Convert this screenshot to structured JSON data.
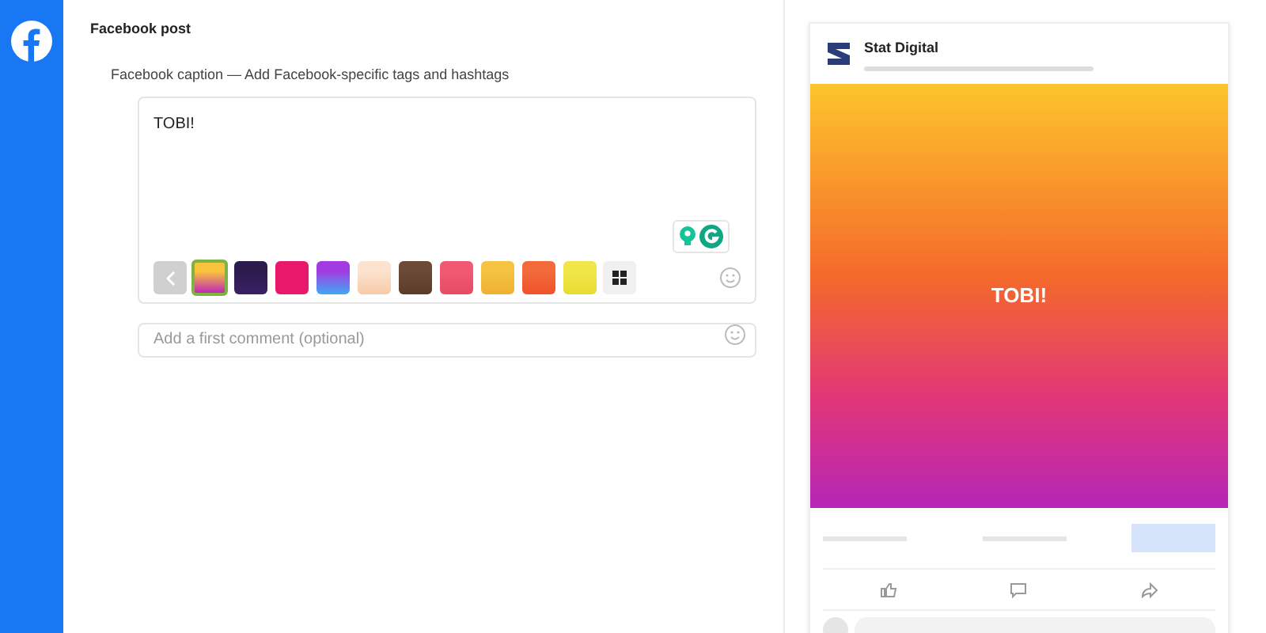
{
  "section_title": "Facebook post",
  "caption_label": "Facebook caption — Add Facebook-specific tags and hashtags",
  "caption": {
    "value": "TOBI!"
  },
  "backgrounds": [
    {
      "color": "#f9c23c",
      "selected": true
    },
    {
      "color": "#2d1b4e",
      "selected": false
    },
    {
      "color": "#e8196b",
      "selected": false
    },
    {
      "color": "#a23ce0",
      "selected": false
    },
    {
      "color": "#fbe3cf",
      "selected": false
    },
    {
      "color": "#6b4a36",
      "selected": false
    },
    {
      "color": "#ef5a72",
      "selected": false
    },
    {
      "color": "#f5c242",
      "selected": false
    },
    {
      "color": "#f26a3a",
      "selected": false
    },
    {
      "color": "#f0e64a",
      "selected": false
    }
  ],
  "comment": {
    "placeholder": "Add a first comment (optional)"
  },
  "preview": {
    "page_name": "Stat Digital",
    "post_text": "TOBI!"
  }
}
